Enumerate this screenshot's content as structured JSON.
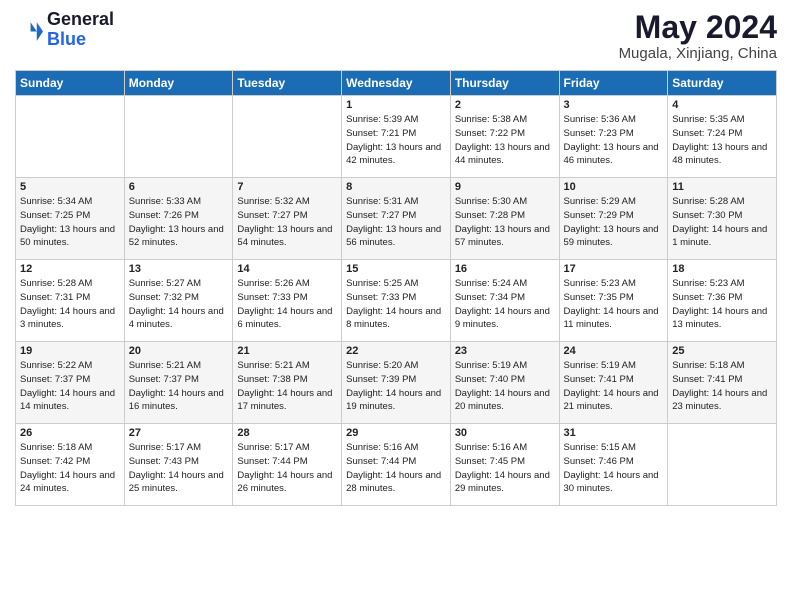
{
  "header": {
    "logo_line1": "General",
    "logo_line2": "Blue",
    "month": "May 2024",
    "location": "Mugala, Xinjiang, China"
  },
  "weekdays": [
    "Sunday",
    "Monday",
    "Tuesday",
    "Wednesday",
    "Thursday",
    "Friday",
    "Saturday"
  ],
  "weeks": [
    [
      {
        "day": "",
        "sunrise": "",
        "sunset": "",
        "daylight": ""
      },
      {
        "day": "",
        "sunrise": "",
        "sunset": "",
        "daylight": ""
      },
      {
        "day": "",
        "sunrise": "",
        "sunset": "",
        "daylight": ""
      },
      {
        "day": "1",
        "sunrise": "Sunrise: 5:39 AM",
        "sunset": "Sunset: 7:21 PM",
        "daylight": "Daylight: 13 hours and 42 minutes."
      },
      {
        "day": "2",
        "sunrise": "Sunrise: 5:38 AM",
        "sunset": "Sunset: 7:22 PM",
        "daylight": "Daylight: 13 hours and 44 minutes."
      },
      {
        "day": "3",
        "sunrise": "Sunrise: 5:36 AM",
        "sunset": "Sunset: 7:23 PM",
        "daylight": "Daylight: 13 hours and 46 minutes."
      },
      {
        "day": "4",
        "sunrise": "Sunrise: 5:35 AM",
        "sunset": "Sunset: 7:24 PM",
        "daylight": "Daylight: 13 hours and 48 minutes."
      }
    ],
    [
      {
        "day": "5",
        "sunrise": "Sunrise: 5:34 AM",
        "sunset": "Sunset: 7:25 PM",
        "daylight": "Daylight: 13 hours and 50 minutes."
      },
      {
        "day": "6",
        "sunrise": "Sunrise: 5:33 AM",
        "sunset": "Sunset: 7:26 PM",
        "daylight": "Daylight: 13 hours and 52 minutes."
      },
      {
        "day": "7",
        "sunrise": "Sunrise: 5:32 AM",
        "sunset": "Sunset: 7:27 PM",
        "daylight": "Daylight: 13 hours and 54 minutes."
      },
      {
        "day": "8",
        "sunrise": "Sunrise: 5:31 AM",
        "sunset": "Sunset: 7:27 PM",
        "daylight": "Daylight: 13 hours and 56 minutes."
      },
      {
        "day": "9",
        "sunrise": "Sunrise: 5:30 AM",
        "sunset": "Sunset: 7:28 PM",
        "daylight": "Daylight: 13 hours and 57 minutes."
      },
      {
        "day": "10",
        "sunrise": "Sunrise: 5:29 AM",
        "sunset": "Sunset: 7:29 PM",
        "daylight": "Daylight: 13 hours and 59 minutes."
      },
      {
        "day": "11",
        "sunrise": "Sunrise: 5:28 AM",
        "sunset": "Sunset: 7:30 PM",
        "daylight": "Daylight: 14 hours and 1 minute."
      }
    ],
    [
      {
        "day": "12",
        "sunrise": "Sunrise: 5:28 AM",
        "sunset": "Sunset: 7:31 PM",
        "daylight": "Daylight: 14 hours and 3 minutes."
      },
      {
        "day": "13",
        "sunrise": "Sunrise: 5:27 AM",
        "sunset": "Sunset: 7:32 PM",
        "daylight": "Daylight: 14 hours and 4 minutes."
      },
      {
        "day": "14",
        "sunrise": "Sunrise: 5:26 AM",
        "sunset": "Sunset: 7:33 PM",
        "daylight": "Daylight: 14 hours and 6 minutes."
      },
      {
        "day": "15",
        "sunrise": "Sunrise: 5:25 AM",
        "sunset": "Sunset: 7:33 PM",
        "daylight": "Daylight: 14 hours and 8 minutes."
      },
      {
        "day": "16",
        "sunrise": "Sunrise: 5:24 AM",
        "sunset": "Sunset: 7:34 PM",
        "daylight": "Daylight: 14 hours and 9 minutes."
      },
      {
        "day": "17",
        "sunrise": "Sunrise: 5:23 AM",
        "sunset": "Sunset: 7:35 PM",
        "daylight": "Daylight: 14 hours and 11 minutes."
      },
      {
        "day": "18",
        "sunrise": "Sunrise: 5:23 AM",
        "sunset": "Sunset: 7:36 PM",
        "daylight": "Daylight: 14 hours and 13 minutes."
      }
    ],
    [
      {
        "day": "19",
        "sunrise": "Sunrise: 5:22 AM",
        "sunset": "Sunset: 7:37 PM",
        "daylight": "Daylight: 14 hours and 14 minutes."
      },
      {
        "day": "20",
        "sunrise": "Sunrise: 5:21 AM",
        "sunset": "Sunset: 7:37 PM",
        "daylight": "Daylight: 14 hours and 16 minutes."
      },
      {
        "day": "21",
        "sunrise": "Sunrise: 5:21 AM",
        "sunset": "Sunset: 7:38 PM",
        "daylight": "Daylight: 14 hours and 17 minutes."
      },
      {
        "day": "22",
        "sunrise": "Sunrise: 5:20 AM",
        "sunset": "Sunset: 7:39 PM",
        "daylight": "Daylight: 14 hours and 19 minutes."
      },
      {
        "day": "23",
        "sunrise": "Sunrise: 5:19 AM",
        "sunset": "Sunset: 7:40 PM",
        "daylight": "Daylight: 14 hours and 20 minutes."
      },
      {
        "day": "24",
        "sunrise": "Sunrise: 5:19 AM",
        "sunset": "Sunset: 7:41 PM",
        "daylight": "Daylight: 14 hours and 21 minutes."
      },
      {
        "day": "25",
        "sunrise": "Sunrise: 5:18 AM",
        "sunset": "Sunset: 7:41 PM",
        "daylight": "Daylight: 14 hours and 23 minutes."
      }
    ],
    [
      {
        "day": "26",
        "sunrise": "Sunrise: 5:18 AM",
        "sunset": "Sunset: 7:42 PM",
        "daylight": "Daylight: 14 hours and 24 minutes."
      },
      {
        "day": "27",
        "sunrise": "Sunrise: 5:17 AM",
        "sunset": "Sunset: 7:43 PM",
        "daylight": "Daylight: 14 hours and 25 minutes."
      },
      {
        "day": "28",
        "sunrise": "Sunrise: 5:17 AM",
        "sunset": "Sunset: 7:44 PM",
        "daylight": "Daylight: 14 hours and 26 minutes."
      },
      {
        "day": "29",
        "sunrise": "Sunrise: 5:16 AM",
        "sunset": "Sunset: 7:44 PM",
        "daylight": "Daylight: 14 hours and 28 minutes."
      },
      {
        "day": "30",
        "sunrise": "Sunrise: 5:16 AM",
        "sunset": "Sunset: 7:45 PM",
        "daylight": "Daylight: 14 hours and 29 minutes."
      },
      {
        "day": "31",
        "sunrise": "Sunrise: 5:15 AM",
        "sunset": "Sunset: 7:46 PM",
        "daylight": "Daylight: 14 hours and 30 minutes."
      },
      {
        "day": "",
        "sunrise": "",
        "sunset": "",
        "daylight": ""
      }
    ]
  ]
}
